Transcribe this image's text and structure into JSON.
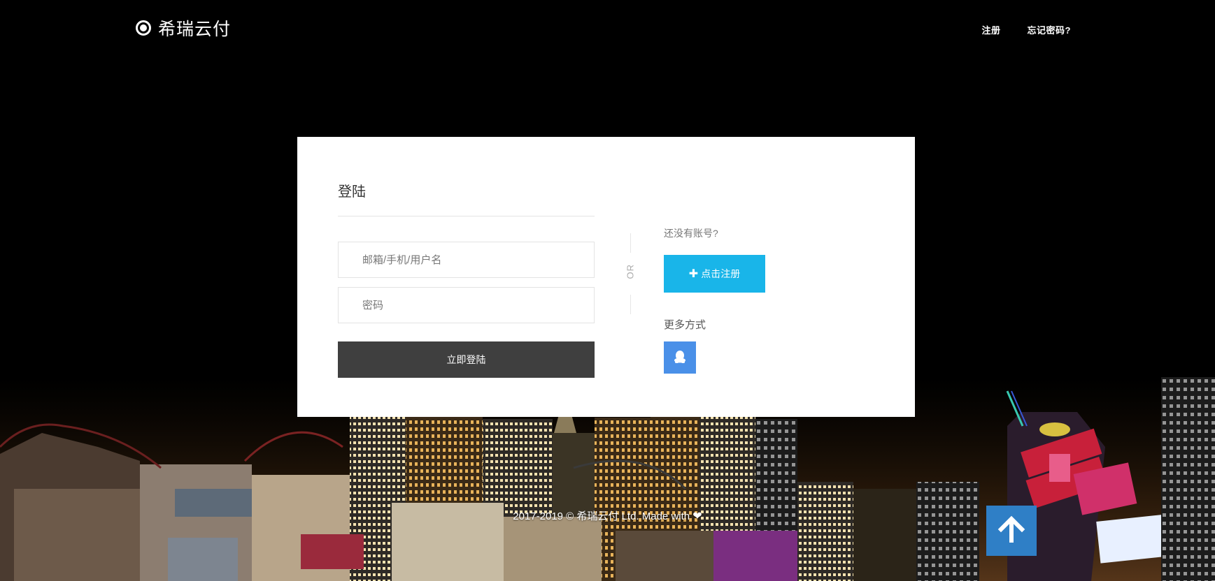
{
  "header": {
    "brand": "希瑞云付",
    "nav": [
      {
        "label": "注册"
      },
      {
        "label": "忘记密码?"
      }
    ]
  },
  "login": {
    "title": "登陆",
    "username_placeholder": "邮箱/手机/用户名",
    "password_placeholder": "密码",
    "submit_label": "立即登陆",
    "separator": "OR",
    "no_account_text": "还没有账号?",
    "register_label": "点击注册",
    "more_ways_text": "更多方式"
  },
  "footer": {
    "copyright": "2017-2019 © 希瑞云付 Ltd. Made with"
  },
  "colors": {
    "register_button": "#19b5e9",
    "login_button": "#3f3f3f",
    "qq_button": "#4a90e8",
    "to_top_button": "#2f7fc6"
  },
  "icons": {
    "brand": "target-icon",
    "register": "plus-icon",
    "qq": "qq-penguin-icon",
    "footer": "heart-icon",
    "to_top": "arrow-up-icon"
  }
}
